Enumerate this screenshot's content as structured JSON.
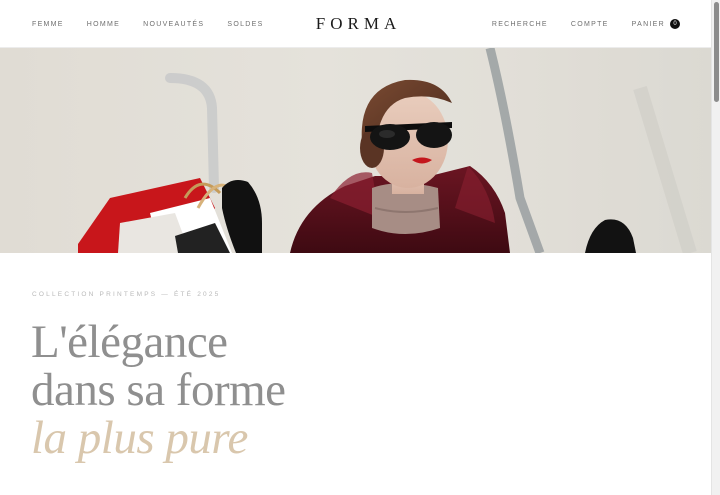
{
  "header": {
    "brand": "FORMA",
    "nav_left": [
      "FEMME",
      "HOMME",
      "NOUVEAUTÉS",
      "SOLDES"
    ],
    "nav_right": {
      "search": "RECHERCHE",
      "account": "COMPTE",
      "cart": "PANIER",
      "cart_count": "0"
    }
  },
  "hero": {
    "image": "woman-with-sunglasses-and-shopping-bags"
  },
  "intro": {
    "eyebrow": "COLLECTION PRINTEMPS — ÉTÉ 2025",
    "headline_line1": "L'élégance",
    "headline_line2": "dans sa forme",
    "headline_accent": "la plus pure"
  },
  "colors": {
    "accent": "#d9c7ad",
    "headline": "#8f8f8f",
    "brand_text": "#1b1b1b"
  }
}
